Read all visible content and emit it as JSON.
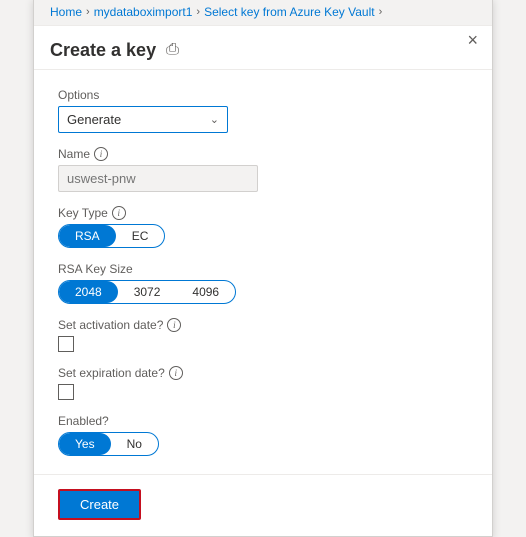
{
  "breadcrumb": {
    "home": "Home",
    "sep1": "›",
    "import": "mydataboximport1",
    "sep2": "›",
    "vault": "Select key from Azure Key Vault",
    "sep3": "›"
  },
  "header": {
    "title": "Create a key",
    "print_icon": "🖶"
  },
  "close_label": "×",
  "form": {
    "options_label": "Options",
    "options_value": "Generate",
    "name_label": "Name",
    "name_placeholder": "uswest-pnw",
    "key_type_label": "Key Type",
    "key_type_options": [
      "RSA",
      "EC"
    ],
    "key_type_selected": "RSA",
    "rsa_key_size_label": "RSA Key Size",
    "rsa_key_size_options": [
      "2048",
      "3072",
      "4096"
    ],
    "rsa_key_size_selected": "2048",
    "activation_label": "Set activation date?",
    "expiration_label": "Set expiration date?",
    "enabled_label": "Enabled?",
    "enabled_options": [
      "Yes",
      "No"
    ],
    "enabled_selected": "Yes"
  },
  "footer": {
    "create_button": "Create"
  },
  "icons": {
    "info": "i",
    "chevron_down": "⌄",
    "close": "×",
    "print": "⎙"
  }
}
